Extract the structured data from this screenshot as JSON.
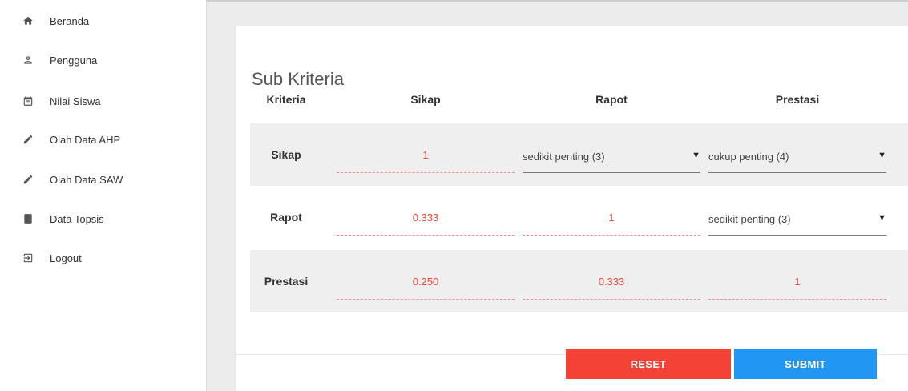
{
  "sidebar": {
    "items": [
      {
        "label": "Beranda",
        "icon": "home-icon"
      },
      {
        "label": "Pengguna",
        "icon": "user-icon"
      },
      {
        "label": "Nilai Siswa",
        "icon": "calendar-icon"
      },
      {
        "label": "Olah Data AHP",
        "icon": "pencil-icon"
      },
      {
        "label": "Olah Data SAW",
        "icon": "pencil-icon"
      },
      {
        "label": "Data Topsis",
        "icon": "book-icon"
      },
      {
        "label": "Logout",
        "icon": "logout-icon"
      }
    ]
  },
  "card": {
    "title": "Sub Kriteria",
    "headers": {
      "kriteria": "Kriteria",
      "sikap": "Sikap",
      "rapot": "Rapot",
      "prestasi": "Prestasi"
    },
    "rows": [
      {
        "label": "Sikap",
        "sikap": "1",
        "rapot": "sedikit penting (3)",
        "prestasi": "cukup penting (4)"
      },
      {
        "label": "Rapot",
        "sikap": "0.333",
        "rapot": "1",
        "prestasi": "sedikit penting (3)"
      },
      {
        "label": "Prestasi",
        "sikap": "0.250",
        "rapot": "0.333",
        "prestasi": "1"
      }
    ]
  },
  "buttons": {
    "reset": "RESET",
    "submit": "SUBMIT"
  },
  "colors": {
    "reset": "#f44336",
    "submit": "#2196f3",
    "value_text": "#f44336"
  }
}
